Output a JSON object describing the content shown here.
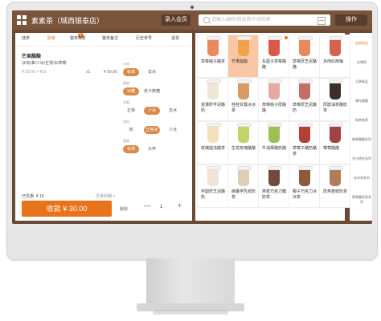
{
  "header": {
    "store_name": "素素茶（城西银泰店）",
    "member_button": "录入会员",
    "search_placeholder": "请输入编码/商品首字母检索",
    "menu_button": "操作"
  },
  "order_tabs": [
    "挂单",
    "取单",
    "整单打折",
    "整单备注",
    "历史单号",
    "退货"
  ],
  "order_badge": "1",
  "cart_item": {
    "name": "芒果酸酸",
    "specs": "冰/标准/少冰/正常冰/草莓",
    "price": "¥ 29.00 × ¥16",
    "qty": "x1",
    "total": "¥ 30.00"
  },
  "options": {
    "groups": [
      {
        "label": "口味",
        "chips": [
          {
            "text": "标准",
            "on": true
          },
          {
            "text": "去冰",
            "on": false
          }
        ]
      },
      {
        "label": "甜度",
        "chips": [
          {
            "text": "冰糖",
            "on": true
          },
          {
            "text": "低卡蔗糖",
            "on": false
          }
        ]
      },
      {
        "label": "冰量",
        "chips": [
          {
            "text": "正常",
            "on": false
          },
          {
            "text": "少冰",
            "on": true
          },
          {
            "text": "去冰",
            "on": false
          }
        ]
      },
      {
        "label": "加料",
        "chips": [
          {
            "text": "热",
            "on": false
          },
          {
            "text": "正常冰",
            "on": true
          },
          {
            "text": "少冰",
            "on": false
          }
        ]
      },
      {
        "label": "规格",
        "chips": [
          {
            "text": "标准",
            "on": true
          },
          {
            "text": "大杯",
            "on": false
          }
        ]
      }
    ]
  },
  "footer_left": {
    "pending_label": "已优惠: ¥ 15",
    "clear_label": "优惠明细 >",
    "pay_button": "收款 ¥ 30.00",
    "delete_label": "删除",
    "qty_minus": "—",
    "qty_value": "1",
    "qty_plus": "+"
  },
  "products": [
    {
      "name": "草莓啵子酪茶",
      "color": "#e88a5d"
    },
    {
      "name": "芒果酸酸",
      "color": "#f2a34a",
      "selected": true
    },
    {
      "name": "车厘子草莓酪酪",
      "color": "#d75a49",
      "dot": true
    },
    {
      "name": "草莓厚芝泥酪酪",
      "color": "#e88a5d"
    },
    {
      "name": "多肉红西柚",
      "color": "#d4624f"
    },
    {
      "name": "苗薄厚芋泥酪奶",
      "color": "#f0e6d8"
    },
    {
      "name": "桂桂甘露冰冰茶",
      "color": "#d89b68"
    },
    {
      "name": "草莓桃子厚酪酪",
      "color": "#e6a9a1"
    },
    {
      "name": "草莓厚芝泥酪奶",
      "color": "#c46e67"
    },
    {
      "name": "厚醇油茶酪奶茶",
      "color": "#3d2e28"
    },
    {
      "name": "玫瑰提浓酪茶",
      "color": "#f2e1bc"
    },
    {
      "name": "生花玫瑰酪酪",
      "color": "#c3d36a"
    },
    {
      "name": "牛油果酪奶酪",
      "color": "#9cc055"
    },
    {
      "name": "草莓子酪奶酪茶",
      "color": "#b33f36"
    },
    {
      "name": "莓莓酪酪",
      "color": "#a14340"
    },
    {
      "name": "芋圆厚芝泥酪奶",
      "color": "#efe4d5"
    },
    {
      "name": "麻薯芋乳鲜奶茶",
      "color": "#dfcdb7"
    },
    {
      "name": "燕麦巧克力糖奶茶",
      "color": "#6e4c39"
    },
    {
      "name": "椰子巧克力冰冰茶",
      "color": "#8b5a3c"
    },
    {
      "name": "厚燕麦鲜奶茶",
      "color": "#b07c5a"
    }
  ],
  "categories": [
    {
      "label": "全部商品",
      "on": true
    },
    {
      "label": "必喝榜",
      "on": false
    },
    {
      "label": "当季新品",
      "on": false
    },
    {
      "label": "果粒酪酪",
      "on": false
    },
    {
      "label": "纯茶推荐",
      "on": false
    },
    {
      "label": "新鲜酪酪系列",
      "on": false
    },
    {
      "label": "冬日热饮系列",
      "on": false
    },
    {
      "label": "冰冰茶系列",
      "on": false
    },
    {
      "label": "厚厚酪奶茶系列",
      "on": false
    }
  ],
  "colors": {
    "brand_brown": "#7a553c",
    "accent_orange": "#e8731a"
  }
}
